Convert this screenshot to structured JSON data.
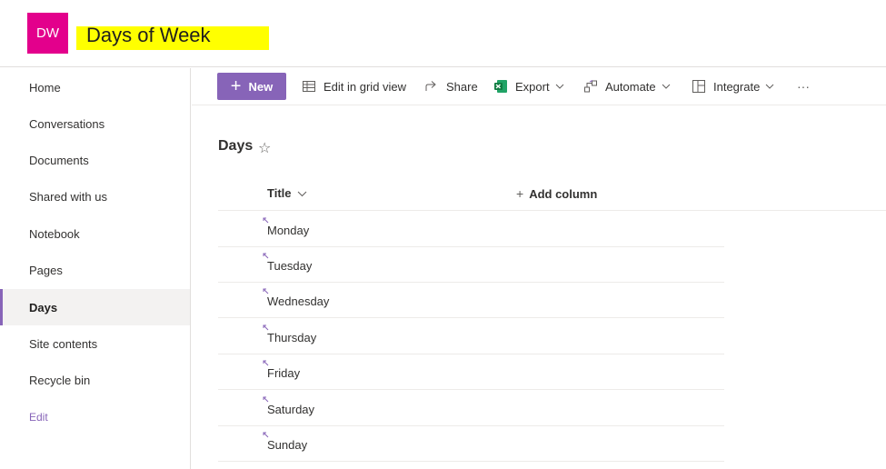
{
  "site": {
    "logo_text": "DW",
    "title": "Days of Week"
  },
  "nav": {
    "items": [
      {
        "label": "Home"
      },
      {
        "label": "Conversations"
      },
      {
        "label": "Documents"
      },
      {
        "label": "Shared with us"
      },
      {
        "label": "Notebook"
      },
      {
        "label": "Pages"
      },
      {
        "label": "Days",
        "selected": true
      },
      {
        "label": "Site contents"
      },
      {
        "label": "Recycle bin"
      }
    ],
    "edit_label": "Edit"
  },
  "commands": {
    "new_label": "New",
    "edit_grid_label": "Edit in grid view",
    "share_label": "Share",
    "export_label": "Export",
    "automate_label": "Automate",
    "integrate_label": "Integrate",
    "more_label": "···"
  },
  "list": {
    "title": "Days",
    "columns": {
      "title_header": "Title",
      "add_column_label": "Add column",
      "add_column_icon": "+"
    },
    "rows": [
      {
        "title": "Monday"
      },
      {
        "title": "Tuesday"
      },
      {
        "title": "Wednesday"
      },
      {
        "title": "Thursday"
      },
      {
        "title": "Friday"
      },
      {
        "title": "Saturday"
      },
      {
        "title": "Sunday"
      }
    ]
  },
  "colors": {
    "accent": "#8764b8",
    "logo_bg": "#e3008c",
    "title_highlight": "#ffff00",
    "excel_green": "#107c41"
  }
}
